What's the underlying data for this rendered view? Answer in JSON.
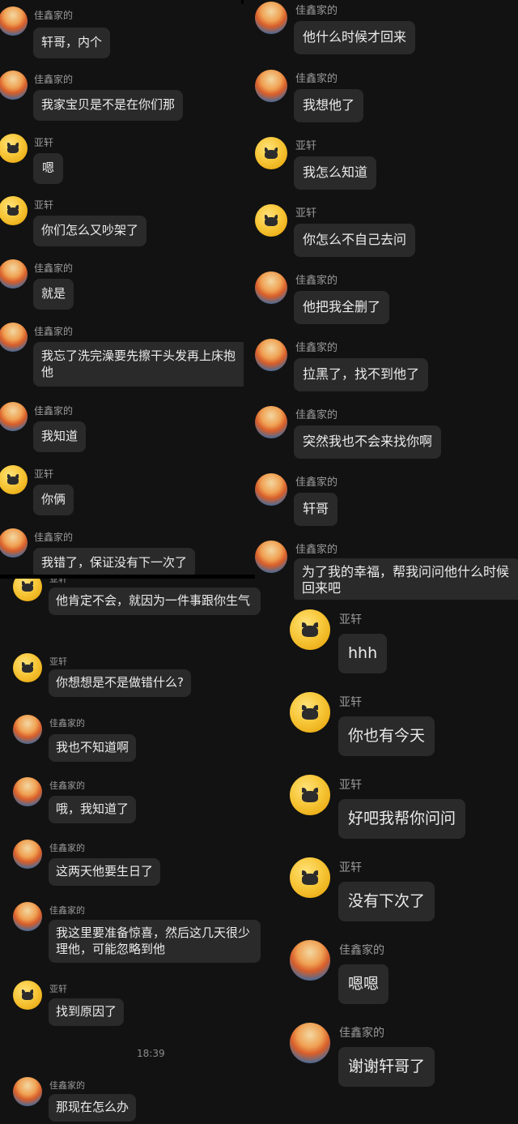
{
  "people": {
    "jiaxin": "佳鑫家的",
    "yaxuan": "亚轩"
  },
  "panel_top_left": [
    {
      "sender": "佳鑫家的",
      "text": "轩哥，内个"
    },
    {
      "sender": "佳鑫家的",
      "text": "我家宝贝是不是在你们那"
    },
    {
      "sender": "亚轩",
      "text": "嗯"
    },
    {
      "sender": "亚轩",
      "text": "你们怎么又吵架了"
    },
    {
      "sender": "佳鑫家的",
      "text": "就是"
    },
    {
      "sender": "佳鑫家的",
      "text": "我忘了洗完澡要先擦干头发再上床抱他"
    },
    {
      "sender": "佳鑫家的",
      "text": "我知道"
    },
    {
      "sender": "亚轩",
      "text": "你俩"
    },
    {
      "sender": "佳鑫家的",
      "text": "我错了，保证没有下一次了"
    }
  ],
  "panel_top_right": [
    {
      "sender": "佳鑫家的",
      "text": "他什么时候才回来"
    },
    {
      "sender": "佳鑫家的",
      "text": "我想他了"
    },
    {
      "sender": "亚轩",
      "text": "我怎么知道"
    },
    {
      "sender": "亚轩",
      "text": "你怎么不自己去问"
    },
    {
      "sender": "佳鑫家的",
      "text": "他把我全删了"
    },
    {
      "sender": "佳鑫家的",
      "text": "拉黑了，找不到他了"
    },
    {
      "sender": "佳鑫家的",
      "text": "突然我也不会来找你啊"
    },
    {
      "sender": "佳鑫家的",
      "text": "轩哥"
    },
    {
      "sender": "佳鑫家的",
      "text": "为了我的幸福，帮我问问他什么时候回来吧"
    }
  ],
  "panel_bottom_left": [
    {
      "sender": "亚轩",
      "text": "他肯定不会，就因为一件事跟你生气"
    },
    {
      "sender": "亚轩",
      "text": "你想想是不是做错什么?"
    },
    {
      "sender": "佳鑫家的",
      "text": "我也不知道啊"
    },
    {
      "sender": "佳鑫家的",
      "text": "哦，我知道了"
    },
    {
      "sender": "佳鑫家的",
      "text": "这两天他要生日了"
    },
    {
      "sender": "佳鑫家的",
      "text": "我这里要准备惊喜，然后这几天很少理他，可能忽略到他"
    },
    {
      "sender": "亚轩",
      "text": "找到原因了"
    },
    {
      "sender": "佳鑫家的",
      "text": "那现在怎么办"
    }
  ],
  "timestamp": "18:39",
  "panel_bottom_right": [
    {
      "sender": "亚轩",
      "text": "hhh"
    },
    {
      "sender": "亚轩",
      "text": "你也有今天"
    },
    {
      "sender": "亚轩",
      "text": "好吧我帮你问问"
    },
    {
      "sender": "亚轩",
      "text": "没有下次了"
    },
    {
      "sender": "佳鑫家的",
      "text": "嗯嗯"
    },
    {
      "sender": "佳鑫家的",
      "text": "谢谢轩哥了"
    }
  ]
}
